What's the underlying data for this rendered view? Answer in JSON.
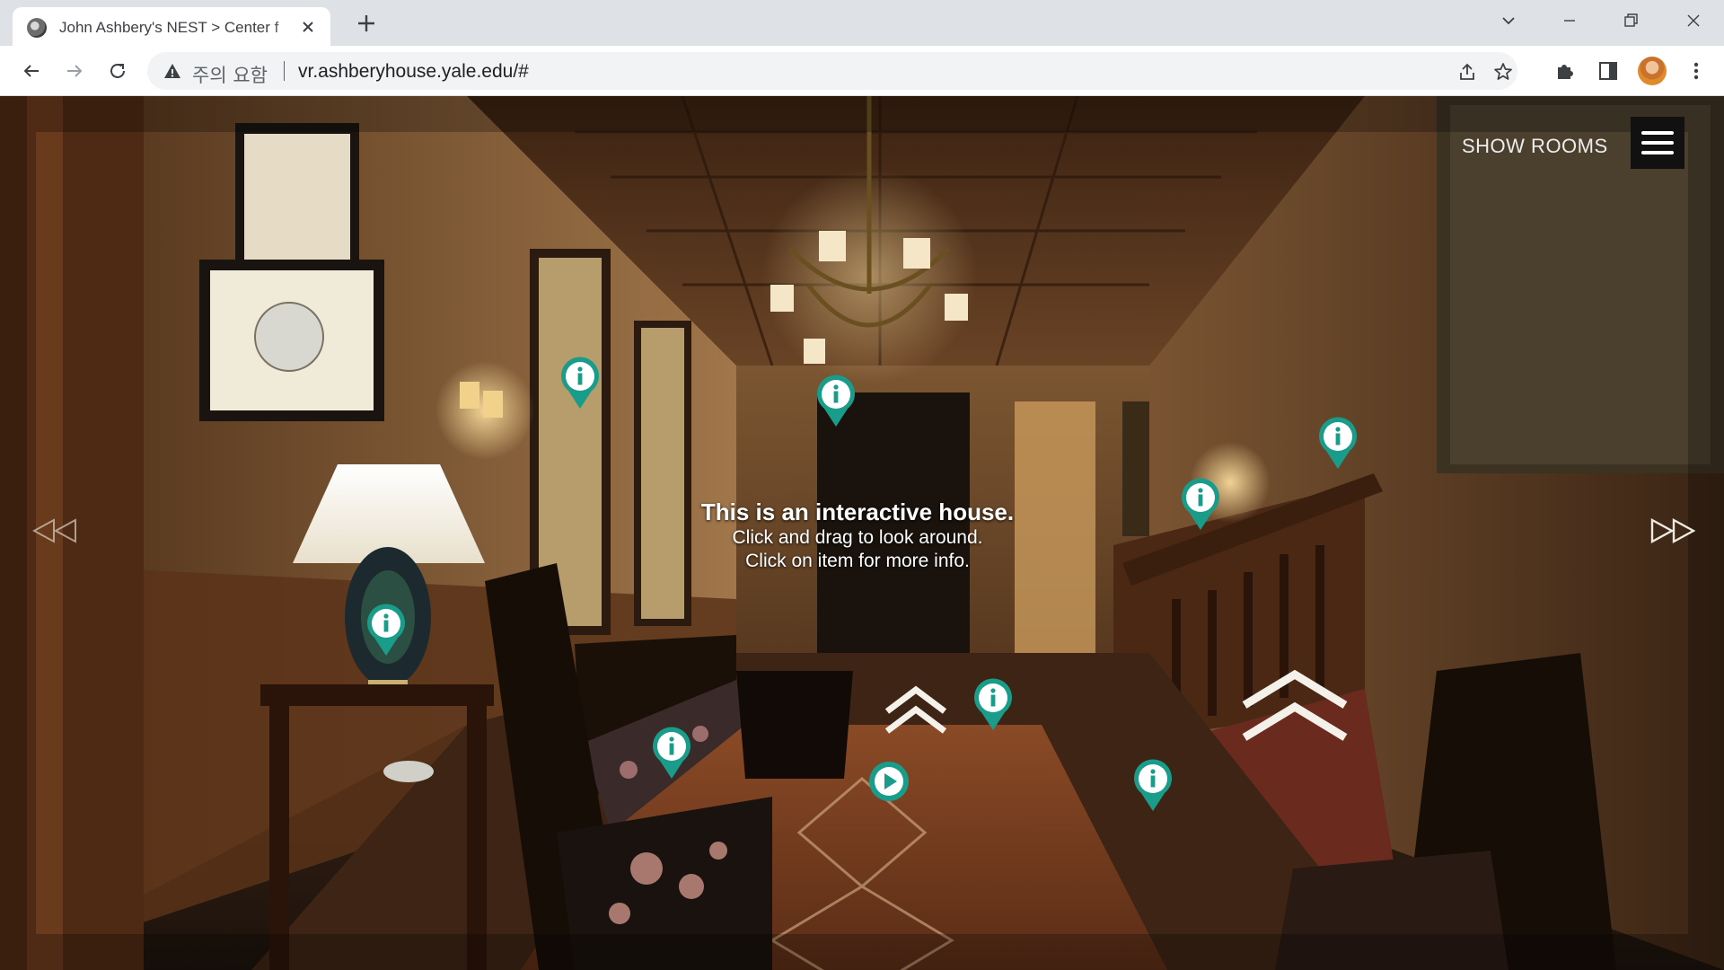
{
  "browser": {
    "tab": {
      "title": "John Ashbery's NEST > Center f"
    },
    "address": {
      "security_label": "주의 요함",
      "url": "vr.ashberyhouse.yale.edu/#"
    }
  },
  "viewer": {
    "show_rooms_label": "SHOW ROOMS",
    "intro": {
      "title": "This is an interactive house.",
      "line1": "Click and drag to look around.",
      "line2": "Click on item for more info."
    },
    "hotspot_color": "#1a9c8a"
  }
}
